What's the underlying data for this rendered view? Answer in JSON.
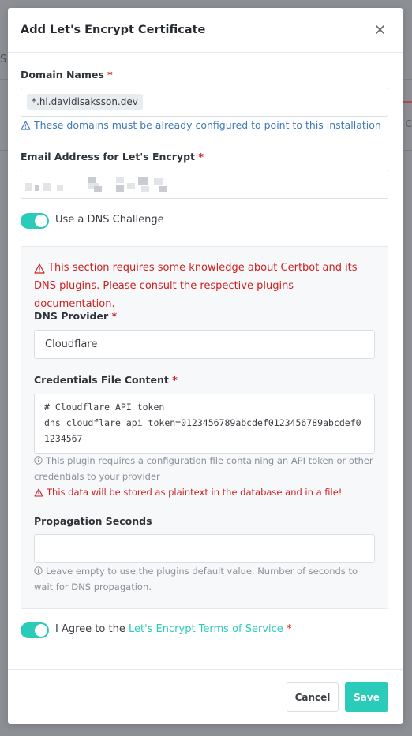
{
  "background": {
    "left_fragment": "S",
    "right_fragment": "C"
  },
  "modal": {
    "title": "Add Let's Encrypt Certificate",
    "close_icon": "close-icon"
  },
  "domain_names": {
    "label": "Domain Names",
    "required_mark": "*",
    "tags": [
      "*.hl.davidisaksson.dev"
    ],
    "info": "These domains must be already configured to point to this installation"
  },
  "email": {
    "label": "Email Address for Let's Encrypt",
    "required_mark": "*"
  },
  "dns_challenge": {
    "toggle_label": "Use a DNS Challenge",
    "enabled": true
  },
  "dns_section": {
    "warning": "This section requires some knowledge about Certbot and its DNS plugins. Please consult the respective plugins documentation.",
    "provider_label": "DNS Provider",
    "provider_required": "*",
    "provider_value": "Cloudflare",
    "credentials_label": "Credentials File Content",
    "credentials_required": "*",
    "credentials_value": "# Cloudflare API token\ndns_cloudflare_api_token=0123456789abcdef0123456789abcdef01234567",
    "credentials_hint": "This plugin requires a configuration file containing an API token or other credentials to your provider",
    "credentials_warning": "This data will be stored as plaintext in the database and in a file!",
    "propagation_label": "Propagation Seconds",
    "propagation_value": "",
    "propagation_hint": "Leave empty to use the plugins default value. Number of seconds to wait for DNS propagation."
  },
  "agree": {
    "prefix": "I Agree to the",
    "link_text": "Let's Encrypt Terms of Service",
    "required_mark": "*",
    "enabled": true
  },
  "footer": {
    "cancel_label": "Cancel",
    "save_label": "Save"
  },
  "colors": {
    "accent": "#2bcbba",
    "danger": "#cd201f",
    "info": "#3f7ab8"
  }
}
